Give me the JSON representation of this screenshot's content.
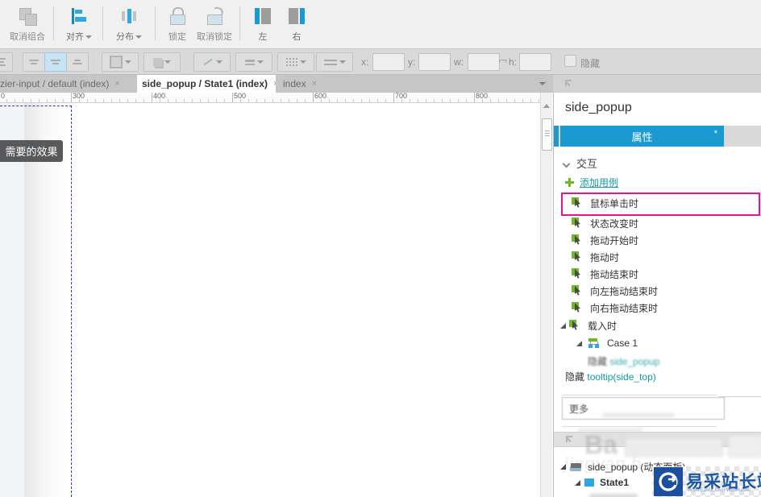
{
  "toolbar_top": {
    "ungroup": "取消组合",
    "align": "对齐",
    "distribute": "分布",
    "lock": "锁定",
    "unlock": "取消锁定",
    "left": "左",
    "right": "右"
  },
  "toolbar_format": {
    "x_label": "x:",
    "y_label": "y:",
    "w_label": "w:",
    "h_label": "h:",
    "hide_label": "隐藏",
    "x_value": "",
    "y_value": "",
    "w_value": "",
    "h_value": ""
  },
  "tab_bar": {
    "tabs": [
      {
        "label": "ic-bezier-input / default (index)",
        "close": "×"
      },
      {
        "label": "side_popup / State1 (index)",
        "close": "×"
      },
      {
        "label": "index",
        "close": "×"
      }
    ]
  },
  "ruler": {
    "labels": [
      "0",
      "300",
      "400",
      "500",
      "600",
      "700",
      "800"
    ]
  },
  "canvas": {
    "tooltip": "需要的效果"
  },
  "inspector": {
    "title": "side_popup",
    "tab_label": "属性",
    "tab_badge": "*",
    "interaction_section": "交互",
    "add_case": "添加用例",
    "events": [
      {
        "label": "鼠标单击时"
      },
      {
        "label": "状态改变时"
      },
      {
        "label": "拖动开始时"
      },
      {
        "label": "拖动时"
      },
      {
        "label": "拖动结束时"
      },
      {
        "label": "向左拖动结束时"
      },
      {
        "label": "向右拖动结束时"
      },
      {
        "label": "载入时"
      }
    ],
    "case_label": "Case 1",
    "action_blurred": {
      "prefix": "隐藏",
      "target": "side_popup"
    },
    "action": {
      "prefix": "隐藏",
      "target": "tooltip(side_top)"
    },
    "more_label": "更多"
  },
  "outline": {
    "item1": "side_popup (动态面板)",
    "item2": "State1"
  },
  "watermark": {
    "ghost1": "Ba",
    "ghost2": "jingyan.b",
    "brand": "易采站长站",
    "brand_sub": "Www.Easck.Com Webmaster"
  },
  "colors": {
    "accent_blue": "#1b9ad2",
    "highlight_magenta": "#ec128f",
    "link_teal": "#0f9aa5",
    "icon_green": "#6fb727",
    "brand_blue": "#1c4fa0"
  }
}
